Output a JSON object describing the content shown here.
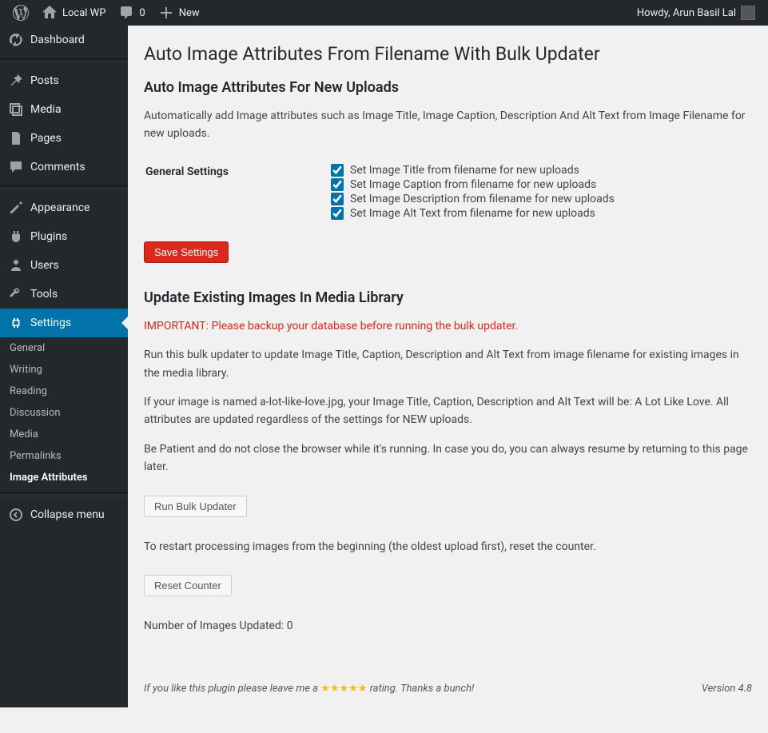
{
  "adminbar": {
    "site_name": "Local WP",
    "comments": "0",
    "new": "New",
    "howdy": "Howdy, Arun Basil Lal"
  },
  "sidebar": {
    "dashboard": "Dashboard",
    "posts": "Posts",
    "media": "Media",
    "pages": "Pages",
    "comments": "Comments",
    "appearance": "Appearance",
    "plugins": "Plugins",
    "users": "Users",
    "tools": "Tools",
    "settings": "Settings",
    "sub": {
      "general": "General",
      "writing": "Writing",
      "reading": "Reading",
      "discussion": "Discussion",
      "media": "Media",
      "permalinks": "Permalinks",
      "image_attributes": "Image Attributes"
    },
    "collapse": "Collapse menu"
  },
  "page": {
    "h1": "Auto Image Attributes From Filename With Bulk Updater",
    "sec1_h2": "Auto Image Attributes For New Uploads",
    "sec1_p": "Automatically add Image attributes such as Image Title, Image Caption, Description And Alt Text from Image Filename for new uploads.",
    "general_settings": "General Settings",
    "cb1": "Set Image Title from filename for new uploads",
    "cb2": "Set Image Caption from filename for new uploads",
    "cb3": "Set Image Description from filename for new uploads",
    "cb4": "Set Image Alt Text from filename for new uploads",
    "save": "Save Settings",
    "sec2_h2": "Update Existing Images In Media Library",
    "warn": "IMPORTANT: Please backup your database before running the bulk updater.",
    "sec2_p1": "Run this bulk updater to update Image Title, Caption, Description and Alt Text from image filename for existing images in the media library.",
    "sec2_p2": "If your image is named a-lot-like-love.jpg, your Image Title, Caption, Description and Alt Text will be: A Lot Like Love. All attributes are updated regardless of the settings for NEW uploads.",
    "sec2_p3": "Be Patient and do not close the browser while it's running. In case you do, you can always resume by returning to this page later.",
    "run": "Run Bulk Updater",
    "sec2_p4": "To restart processing images from the beginning (the oldest upload first), reset the counter.",
    "reset": "Reset Counter",
    "count_label": "Number of Images Updated: ",
    "count": "0",
    "footer_pre": "If you like this plugin please leave me a ",
    "footer_stars": "★★★★★",
    "footer_post": " rating. Thanks a bunch!",
    "version": "Version 4.8"
  }
}
